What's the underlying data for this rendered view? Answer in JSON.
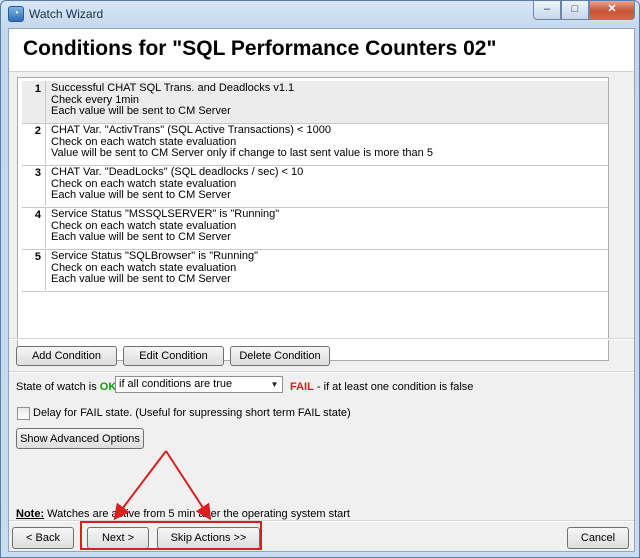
{
  "window": {
    "title": "Watch Wizard",
    "icon": "wizard-app-icon",
    "caption_buttons": [
      "minimize-icon",
      "maximize-icon",
      "close-icon"
    ]
  },
  "header": {
    "title": "Conditions for \"SQL Performance Counters 02\""
  },
  "conditions": [
    {
      "num": "1",
      "lines": [
        "Successful CHAT SQL Trans. and Deadlocks v1.1",
        "Check every 1min",
        "Each value will be sent to CM Server"
      ]
    },
    {
      "num": "2",
      "lines": [
        "CHAT Var. \"ActivTrans\" (SQL Active Transactions) < 1000",
        "Check on each watch state evaluation",
        "Value will be sent to CM Server only if change to last sent value is more than 5"
      ]
    },
    {
      "num": "3",
      "lines": [
        "CHAT Var. \"DeadLocks\" (SQL deadlocks / sec) < 10",
        "Check on each watch state evaluation",
        "Each value will be sent to CM Server"
      ]
    },
    {
      "num": "4",
      "lines": [
        "Service Status \"MSSQLSERVER\" is \"Running\"",
        "Check on each watch state evaluation",
        "Each value will be sent to CM Server"
      ]
    },
    {
      "num": "5",
      "lines": [
        "Service Status \"SQLBrowser\" is \"Running\"",
        "Check on each watch state evaluation",
        "Each value will be sent to CM Server"
      ]
    }
  ],
  "condition_buttons": {
    "add": "Add Condition",
    "edit": "Edit Condition",
    "delete": "Delete Condition"
  },
  "state": {
    "prefix": "State of watch is",
    "ok": "OK",
    "select_value": "if all conditions are true",
    "fail": "FAIL",
    "fail_suffix": " - if at least one condition is false"
  },
  "delay": {
    "checked": false,
    "label": "Delay for FAIL state. (Useful for supressing short term FAIL state)"
  },
  "advanced_button": "Show Advanced Options",
  "note": {
    "label": "Note:",
    "text": " Watches are active from 5 min after the operating system start"
  },
  "nav": {
    "back": "< Back",
    "next": "Next >",
    "skip": "Skip Actions >>",
    "cancel": "Cancel"
  },
  "colors": {
    "ok": "#129c12",
    "fail": "#e01818",
    "annotation": "#d91f1f"
  }
}
